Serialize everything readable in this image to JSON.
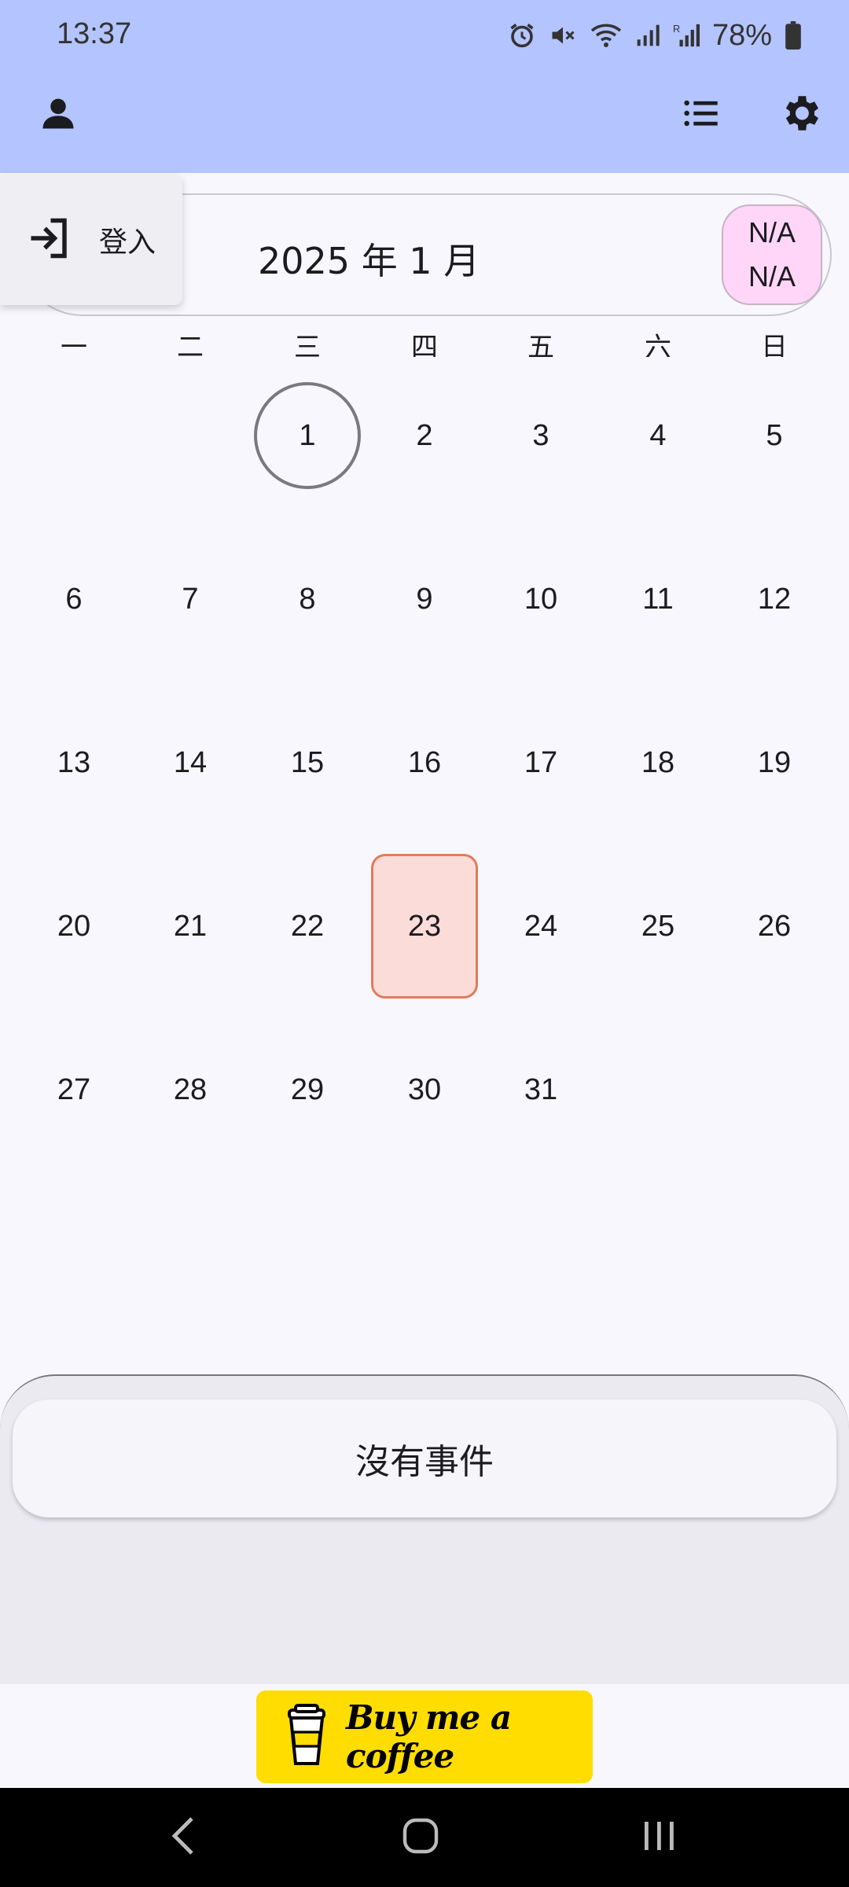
{
  "status_bar": {
    "time": "13:37",
    "battery_percent": "78%",
    "icons": [
      "alarm-icon",
      "mute-icon",
      "wifi-icon",
      "signal-icon",
      "roaming-signal-icon",
      "battery-icon"
    ]
  },
  "app_bar": {
    "left_icon": "person-icon",
    "right_icons": [
      "list-icon",
      "settings-gear-icon"
    ],
    "background": "#b3c4ff"
  },
  "login_menu": {
    "icon": "login-arrow-icon",
    "label": "登入"
  },
  "month_header": {
    "title": "2025 年 1 月",
    "badge_top": "N/A",
    "badge_bottom": "N/A",
    "badge_color": "#ffd6f8"
  },
  "weekdays": [
    "一",
    "二",
    "三",
    "四",
    "五",
    "六",
    "日"
  ],
  "calendar": {
    "weeks": [
      [
        "",
        "",
        "1",
        "2",
        "3",
        "4",
        "5"
      ],
      [
        "6",
        "7",
        "8",
        "9",
        "10",
        "11",
        "12"
      ],
      [
        "13",
        "14",
        "15",
        "16",
        "17",
        "18",
        "19"
      ],
      [
        "20",
        "21",
        "22",
        "23",
        "24",
        "25",
        "26"
      ],
      [
        "27",
        "28",
        "29",
        "30",
        "31",
        "",
        ""
      ]
    ],
    "circled_day": "1",
    "selected_day": "23",
    "selected_color": "#fbdcd8",
    "selected_border": "#e07b5d"
  },
  "events": {
    "empty_text": "沒有事件"
  },
  "coffee_button": {
    "label": "Buy me a coffee",
    "icon": "coffee-cup-icon",
    "color": "#ffdd00"
  },
  "nav_bar": {
    "buttons": [
      "back-icon",
      "home-icon",
      "recents-icon"
    ]
  }
}
